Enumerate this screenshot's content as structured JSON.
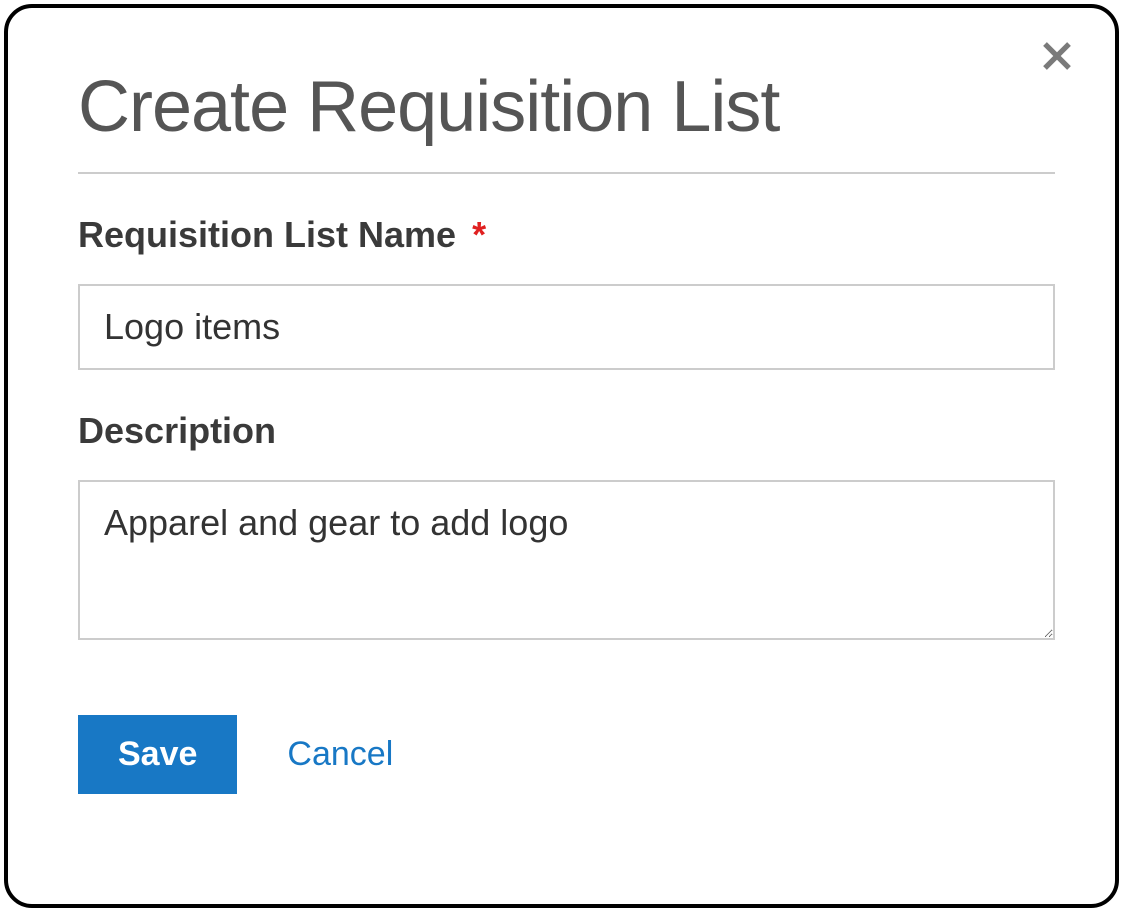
{
  "modal": {
    "title": "Create Requisition List",
    "fields": {
      "name": {
        "label": "Requisition List Name",
        "required_mark": "*",
        "value": "Logo items"
      },
      "description": {
        "label": "Description",
        "value": "Apparel and gear to add logo"
      }
    },
    "actions": {
      "save_label": "Save",
      "cancel_label": "Cancel"
    }
  }
}
